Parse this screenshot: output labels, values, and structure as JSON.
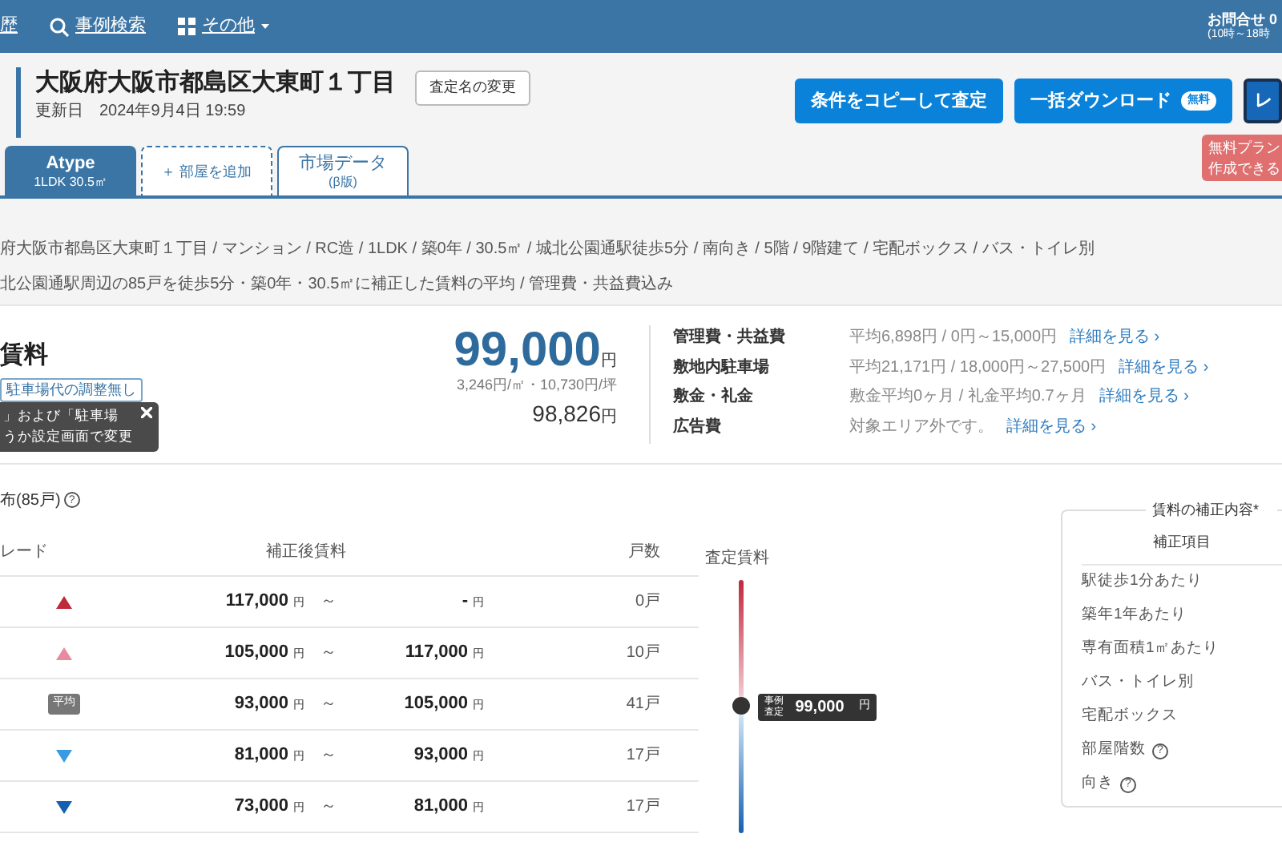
{
  "nav": {
    "items": [
      {
        "label": "歴",
        "kind": "plain",
        "caret": false
      },
      {
        "label": "事例検索",
        "kind": "search",
        "caret": false
      },
      {
        "label": "その他",
        "kind": "menu",
        "caret": true
      }
    ],
    "contact": {
      "line_1": "お問合せ 0",
      "line_2": "(10時～18時"
    }
  },
  "header": {
    "title": "大阪府大阪市都島区大東町１丁目",
    "updated": "更新日　2024年9月4日 19:59",
    "rename_button": "査定名の変更",
    "actions": [
      {
        "label": "条件をコピーして査定",
        "kind": "primary"
      },
      {
        "label": "一括ダウンロード",
        "kind": "primary",
        "badge": "無料"
      },
      {
        "label": "レ",
        "kind": "dark"
      }
    ],
    "notice": [
      "無料プラン",
      "作成できる"
    ]
  },
  "tabs": [
    {
      "label": "Atype",
      "sub": "1LDK 30.5㎡",
      "kind": "room",
      "selected": true
    },
    {
      "label": "＋ 部屋を追加",
      "kind": "add",
      "selected": false
    },
    {
      "label": "市場データ",
      "sub": "(β版)",
      "kind": "room",
      "selected": false
    }
  ],
  "summary": {
    "conditions": "府大阪市都島区大東町１丁目 / マンション / RC造 / 1LDK / 築0年 / 30.5㎡ / 城北公園通駅徒歩5分 / 南向き / 5階 / 9階建て / 宅配ボックス / バス・トイレ別",
    "basis": "北公園通駅周辺の85戸を徒歩5分・築0年・30.5㎡に補正した賃料の平均 / 管理費・共益費込み"
  },
  "rent": {
    "title": "賃料",
    "tag": "駐車場代の調整無し",
    "tooltip": [
      "」および「駐車場",
      "うか設定画面で変更"
    ],
    "price": "99,000",
    "price_unit": "円",
    "unit_prices": "3,246円/㎡・10,730円/坪",
    "price_2": "98,826",
    "price_2_unit": "円",
    "details": [
      {
        "label": "管理費・共益費",
        "value": "平均6,898円 / 0円～15,000円",
        "link": "詳細を見る ›"
      },
      {
        "label": "敷地内駐車場",
        "value": "平均21,171円 / 18,000円～27,500円",
        "link": "詳細を見る ›"
      },
      {
        "label": "敷金・礼金",
        "value": "敷金平均0ヶ月 / 礼金平均0.7ヶ月",
        "link": "詳細を見る ›"
      },
      {
        "label": "広告費",
        "value": "対象エリア外です。",
        "link": "詳細を見る ›"
      }
    ]
  },
  "distribution": {
    "title": "布(85戸)",
    "help": "?",
    "columns": [
      "レード",
      "補正後賃料",
      "戸数",
      "査定賃料"
    ],
    "rows": [
      {
        "kind": "up2",
        "from": "117,000",
        "from_unit": "円",
        "sep": "～",
        "to": "-",
        "to_unit": "円",
        "count": "0戸"
      },
      {
        "kind": "up",
        "from": "105,000",
        "from_unit": "円",
        "sep": "～",
        "to": "117,000",
        "to_unit": "円",
        "count": "10戸"
      },
      {
        "kind": "average",
        "badge": "平均",
        "from": "93,000",
        "from_unit": "円",
        "sep": "～",
        "to": "105,000",
        "to_unit": "円",
        "count": "41戸"
      },
      {
        "kind": "down",
        "from": "81,000",
        "from_unit": "円",
        "sep": "～",
        "to": "93,000",
        "to_unit": "円",
        "count": "17戸"
      },
      {
        "kind": "down2",
        "from": "73,000",
        "from_unit": "円",
        "sep": "～",
        "to": "81,000",
        "to_unit": "円",
        "count": "17戸"
      }
    ],
    "marker": {
      "label": "事例査定",
      "value": "99,000",
      "unit": "円",
      "level": 0.5
    }
  },
  "adjustments": {
    "title": "賃料の補正内容*",
    "header": "補正項目",
    "items": [
      {
        "label": "駅徒歩1分あたり"
      },
      {
        "label": "築年1年あたり"
      },
      {
        "label": "専有面積1㎡あたり"
      },
      {
        "label": "バス・トイレ別"
      },
      {
        "label": "宅配ボックス"
      },
      {
        "label": "部屋階数",
        "help": "?"
      },
      {
        "label": "向き",
        "help": "?"
      }
    ]
  }
}
